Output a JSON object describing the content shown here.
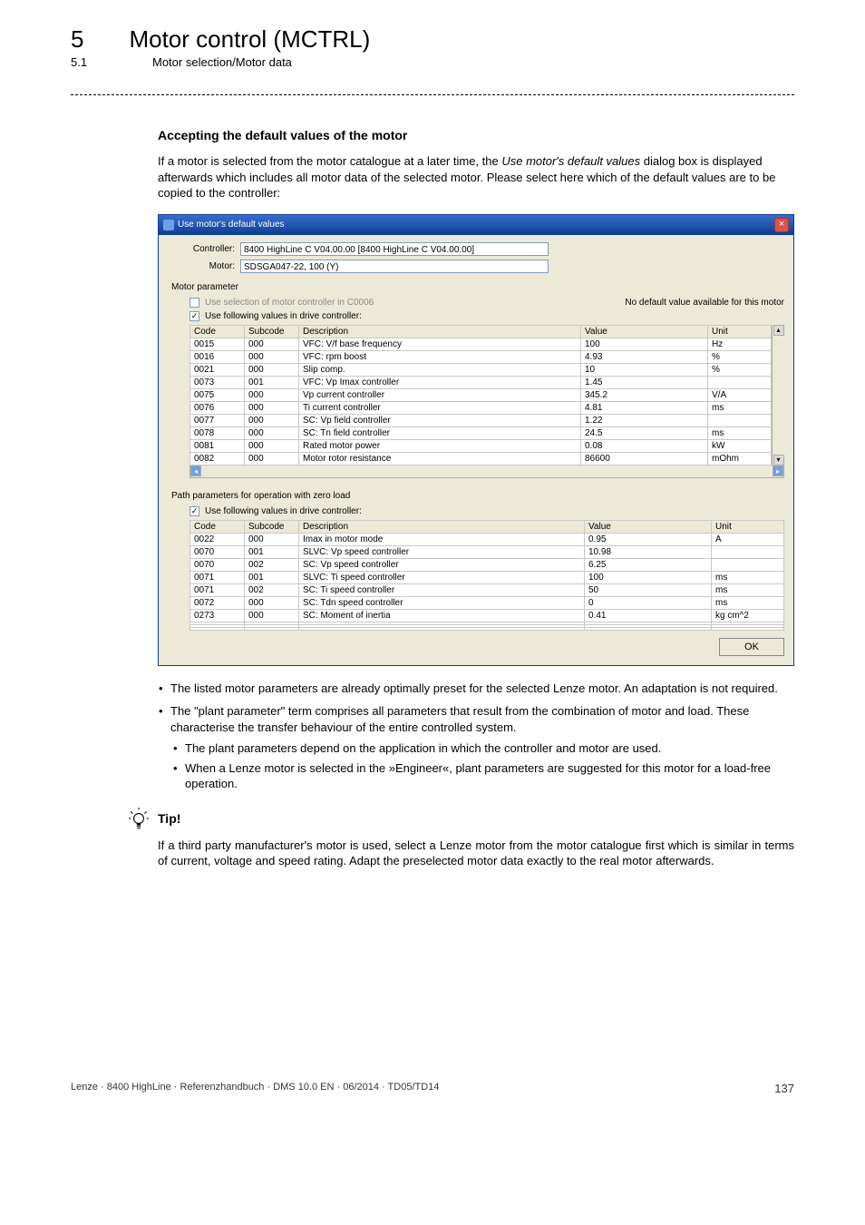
{
  "chapter": {
    "num": "5",
    "title": "Motor control (MCTRL)"
  },
  "subsection": {
    "num": "5.1",
    "title": "Motor selection/Motor data"
  },
  "heading": "Accepting the default values of the motor",
  "intro_1": "If a motor is selected from the motor catalogue at a later time, the ",
  "intro_em": "Use motor's default values",
  "intro_2": " dialog box is displayed afterwards which includes all motor data of the selected motor. Please select here which of the default values are to be copied to the controller:",
  "dialog": {
    "title": "Use motor's default values",
    "controller_label": "Controller:",
    "controller_value": "8400 HighLine C V04.00.00 [8400 HighLine C V04.00.00]",
    "motor_label": "Motor:",
    "motor_value": "SDSGA047-22, 100 (Y)",
    "section_motor_label": "Motor parameter",
    "cb_controller": "Use selection of motor controller in C0006",
    "cb_controller_note": "No default value available for this motor",
    "cb_values": "Use following values in drive controller:",
    "section_path_label": "Path parameters for operation with zero load",
    "cb_values2": "Use following values in drive controller:",
    "headers": {
      "code": "Code",
      "subcode": "Subcode",
      "description": "Description",
      "value": "Value",
      "unit": "Unit"
    },
    "table1": [
      {
        "code": "0015",
        "sub": "000",
        "desc": "VFC: V/f base frequency",
        "val": "100",
        "unit": "Hz"
      },
      {
        "code": "0016",
        "sub": "000",
        "desc": "VFC: rpm boost",
        "val": "4.93",
        "unit": "%"
      },
      {
        "code": "0021",
        "sub": "000",
        "desc": "Slip comp.",
        "val": "10",
        "unit": "%"
      },
      {
        "code": "0073",
        "sub": "001",
        "desc": "VFC: Vp Imax controller",
        "val": "1.45",
        "unit": ""
      },
      {
        "code": "0075",
        "sub": "000",
        "desc": "Vp current controller",
        "val": "345.2",
        "unit": "V/A"
      },
      {
        "code": "0076",
        "sub": "000",
        "desc": "Ti current controller",
        "val": "4.81",
        "unit": "ms"
      },
      {
        "code": "0077",
        "sub": "000",
        "desc": "SC: Vp field controller",
        "val": "1.22",
        "unit": ""
      },
      {
        "code": "0078",
        "sub": "000",
        "desc": "SC: Tn field controller",
        "val": "24.5",
        "unit": "ms"
      },
      {
        "code": "0081",
        "sub": "000",
        "desc": "Rated motor power",
        "val": "0.08",
        "unit": "kW"
      },
      {
        "code": "0082",
        "sub": "000",
        "desc": "Motor rotor resistance",
        "val": "86600",
        "unit": "mOhm"
      }
    ],
    "table2": [
      {
        "code": "0022",
        "sub": "000",
        "desc": "Imax in motor mode",
        "val": "0.95",
        "unit": "A"
      },
      {
        "code": "0070",
        "sub": "001",
        "desc": "SLVC: Vp speed controller",
        "val": "10.98",
        "unit": ""
      },
      {
        "code": "0070",
        "sub": "002",
        "desc": "SC: Vp speed controller",
        "val": "6.25",
        "unit": ""
      },
      {
        "code": "0071",
        "sub": "001",
        "desc": "SLVC: Ti speed controller",
        "val": "100",
        "unit": "ms"
      },
      {
        "code": "0071",
        "sub": "002",
        "desc": "SC: Ti speed controller",
        "val": "50",
        "unit": "ms"
      },
      {
        "code": "0072",
        "sub": "000",
        "desc": "SC: Tdn speed controller",
        "val": "0",
        "unit": "ms"
      },
      {
        "code": "0273",
        "sub": "000",
        "desc": "SC: Moment of inertia",
        "val": "0.41",
        "unit": "kg cm^2"
      },
      {
        "code": "",
        "sub": "",
        "desc": "",
        "val": "",
        "unit": ""
      },
      {
        "code": "",
        "sub": "",
        "desc": "",
        "val": "",
        "unit": ""
      },
      {
        "code": "",
        "sub": "",
        "desc": "",
        "val": "",
        "unit": ""
      }
    ],
    "ok": "OK"
  },
  "bullets": {
    "b1": "The listed motor parameters are already optimally preset for the selected Lenze motor. An adaptation is not required.",
    "b2": "The \"plant parameter\" term comprises all parameters that result from the combination of motor and load. These characterise the transfer behaviour of the entire controlled system.",
    "b2a": "The plant parameters depend on the application in which the controller and motor are used.",
    "b2b": "When a Lenze motor is selected in the »Engineer«, plant parameters are suggested for this motor for a load-free operation."
  },
  "tip": {
    "label": "Tip!",
    "text": "If a third party manufacturer's motor is used, select a Lenze motor from the motor catalogue first which is similar in terms of current, voltage and speed rating. Adapt the preselected motor data exactly to the real motor afterwards."
  },
  "footer": {
    "left": "Lenze · 8400 HighLine · Referenzhandbuch · DMS 10.0 EN · 06/2014 · TD05/TD14",
    "page": "137"
  }
}
